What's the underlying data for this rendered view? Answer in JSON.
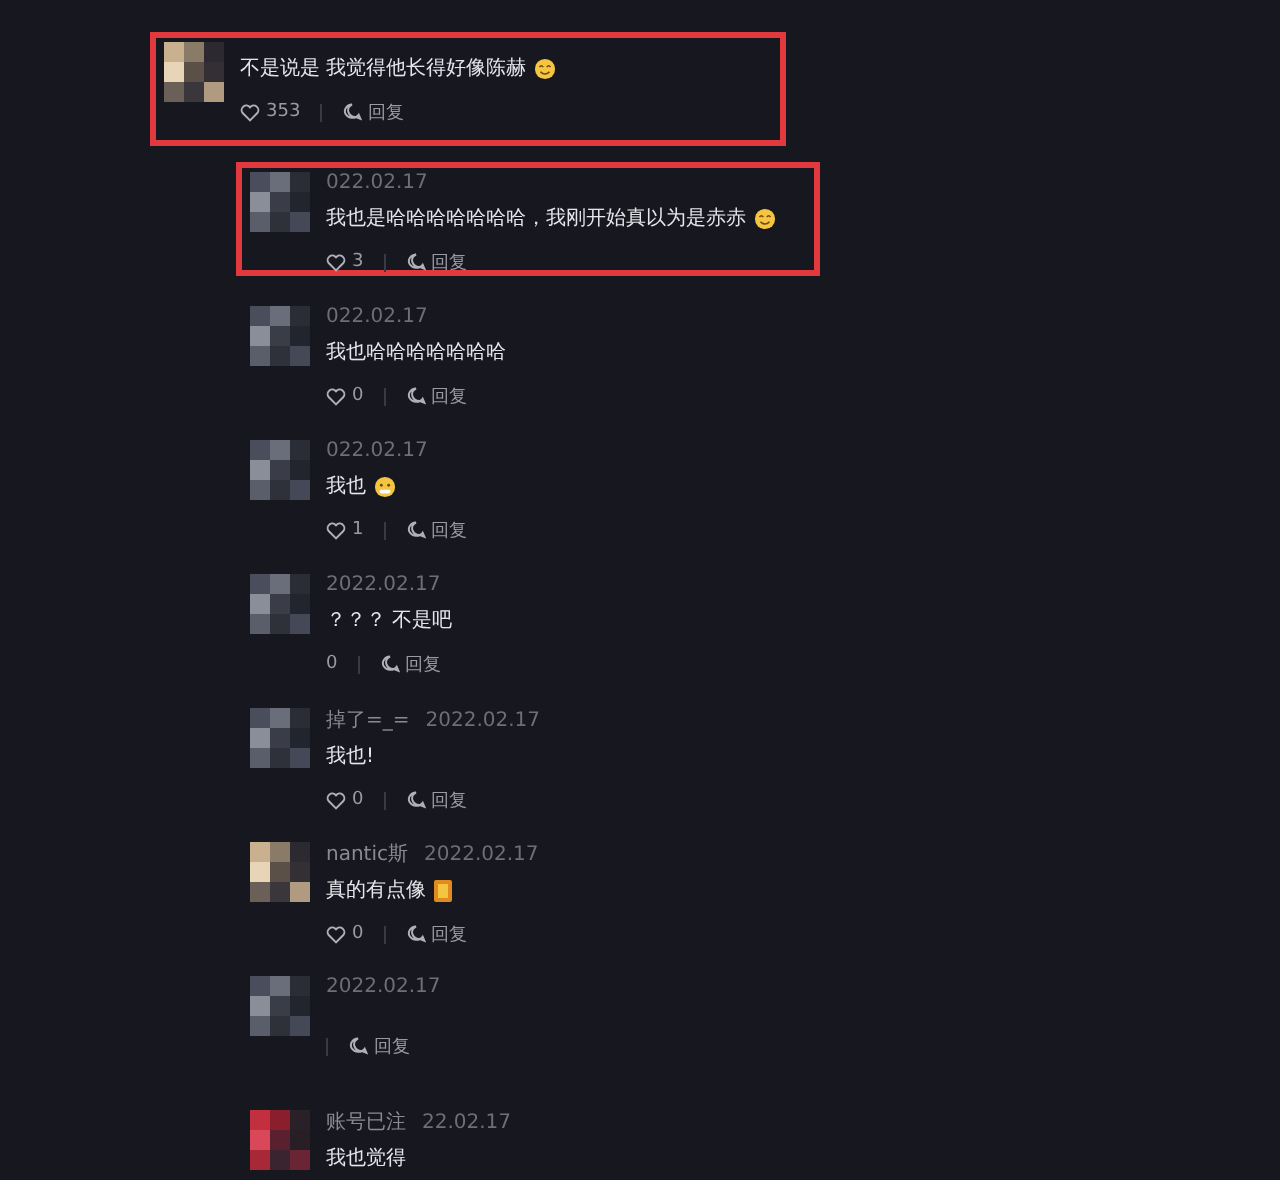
{
  "comments": [
    {
      "text": "不是说是 我觉得他长得好像陈赫",
      "emoji": {
        "kind": "grin"
      },
      "likes": "353",
      "reply": "回复",
      "highlighted": true,
      "children": [
        {
          "date": "022.02.17",
          "text": "我也是哈哈哈哈哈哈哈，我刚开始真以为是赤赤",
          "emoji": {
            "kind": "grin"
          },
          "likes": "3",
          "reply": "回复",
          "highlighted": true
        },
        {
          "date": "022.02.17",
          "text": "我也哈哈哈哈哈哈哈",
          "likes": "0",
          "reply": "回复",
          "highlighted": false
        },
        {
          "date": "022.02.17",
          "text": "我也",
          "emoji": {
            "kind": "shy"
          },
          "likes": "1",
          "reply": "回复",
          "highlighted": false
        },
        {
          "date": "2022.02.17",
          "text": "？？？ 不是吧",
          "likes": "0",
          "heart_hidden": true,
          "reply": "回复",
          "highlighted": false
        },
        {
          "name": "掉了=_=",
          "date": "2022.02.17",
          "text": "我也!",
          "likes": "0",
          "reply": "回复",
          "highlighted": false
        },
        {
          "name": "nantic斯",
          "date": "2022.02.17",
          "text": "真的有点像",
          "emoji": {
            "kind": "card"
          },
          "likes": "0",
          "reply": "回复",
          "highlighted": false
        },
        {
          "date": "2022.02.17",
          "reply": "回复",
          "highlighted": false
        },
        {
          "name": "账号已注",
          "date": "22.02.17",
          "text": "我也觉得",
          "highlighted": false
        }
      ]
    }
  ]
}
